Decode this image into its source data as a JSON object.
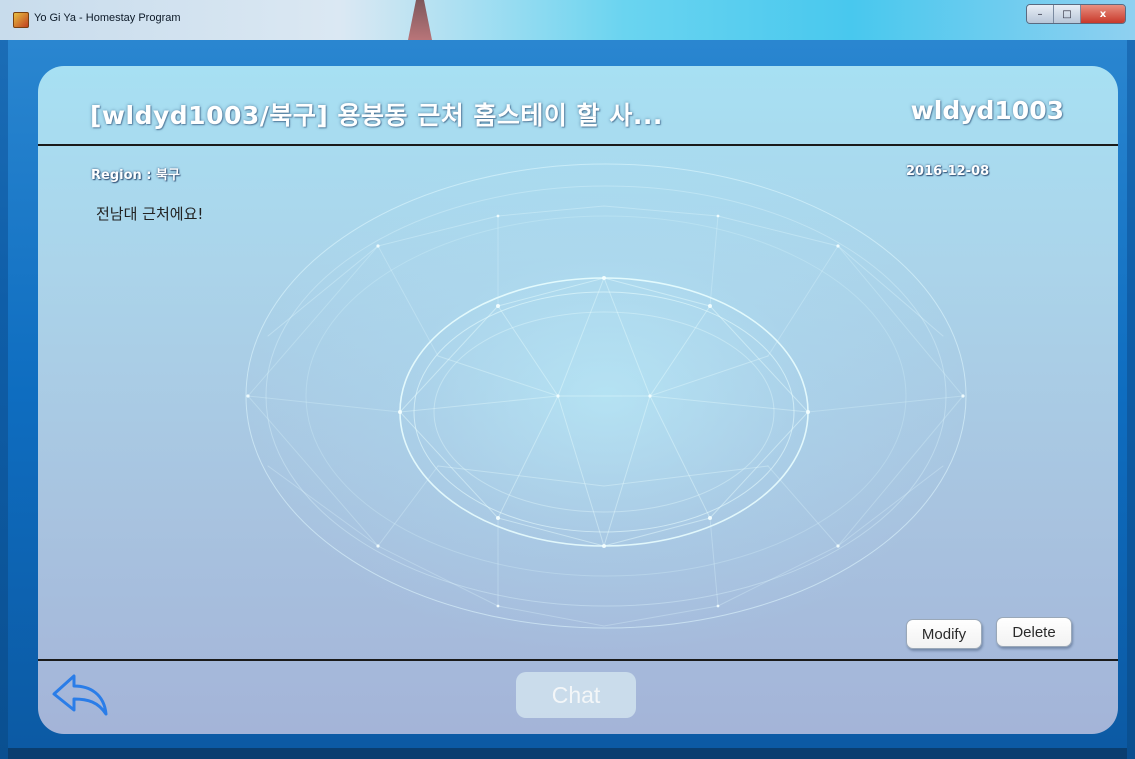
{
  "window": {
    "title": "Yo Gi Ya - Homestay Program",
    "minimize_symbol": "–",
    "maximize_symbol": "□",
    "close_symbol": "x"
  },
  "post": {
    "title": "[wldyd1003/북구]  용봉동 근처 홈스테이 할 사...",
    "author": "wldyd1003",
    "region_label": "Region : 북구",
    "date": "2016-12-08",
    "content": "전남대 근처에요!"
  },
  "actions": {
    "modify_label": "Modify",
    "delete_label": "Delete",
    "chat_label": "Chat",
    "chat_enabled": false,
    "back_icon": "back-arrow-icon"
  },
  "colors": {
    "title_text": "#ffffff",
    "divider": "#1a1a1a",
    "back_icon": "#2a7de8"
  }
}
